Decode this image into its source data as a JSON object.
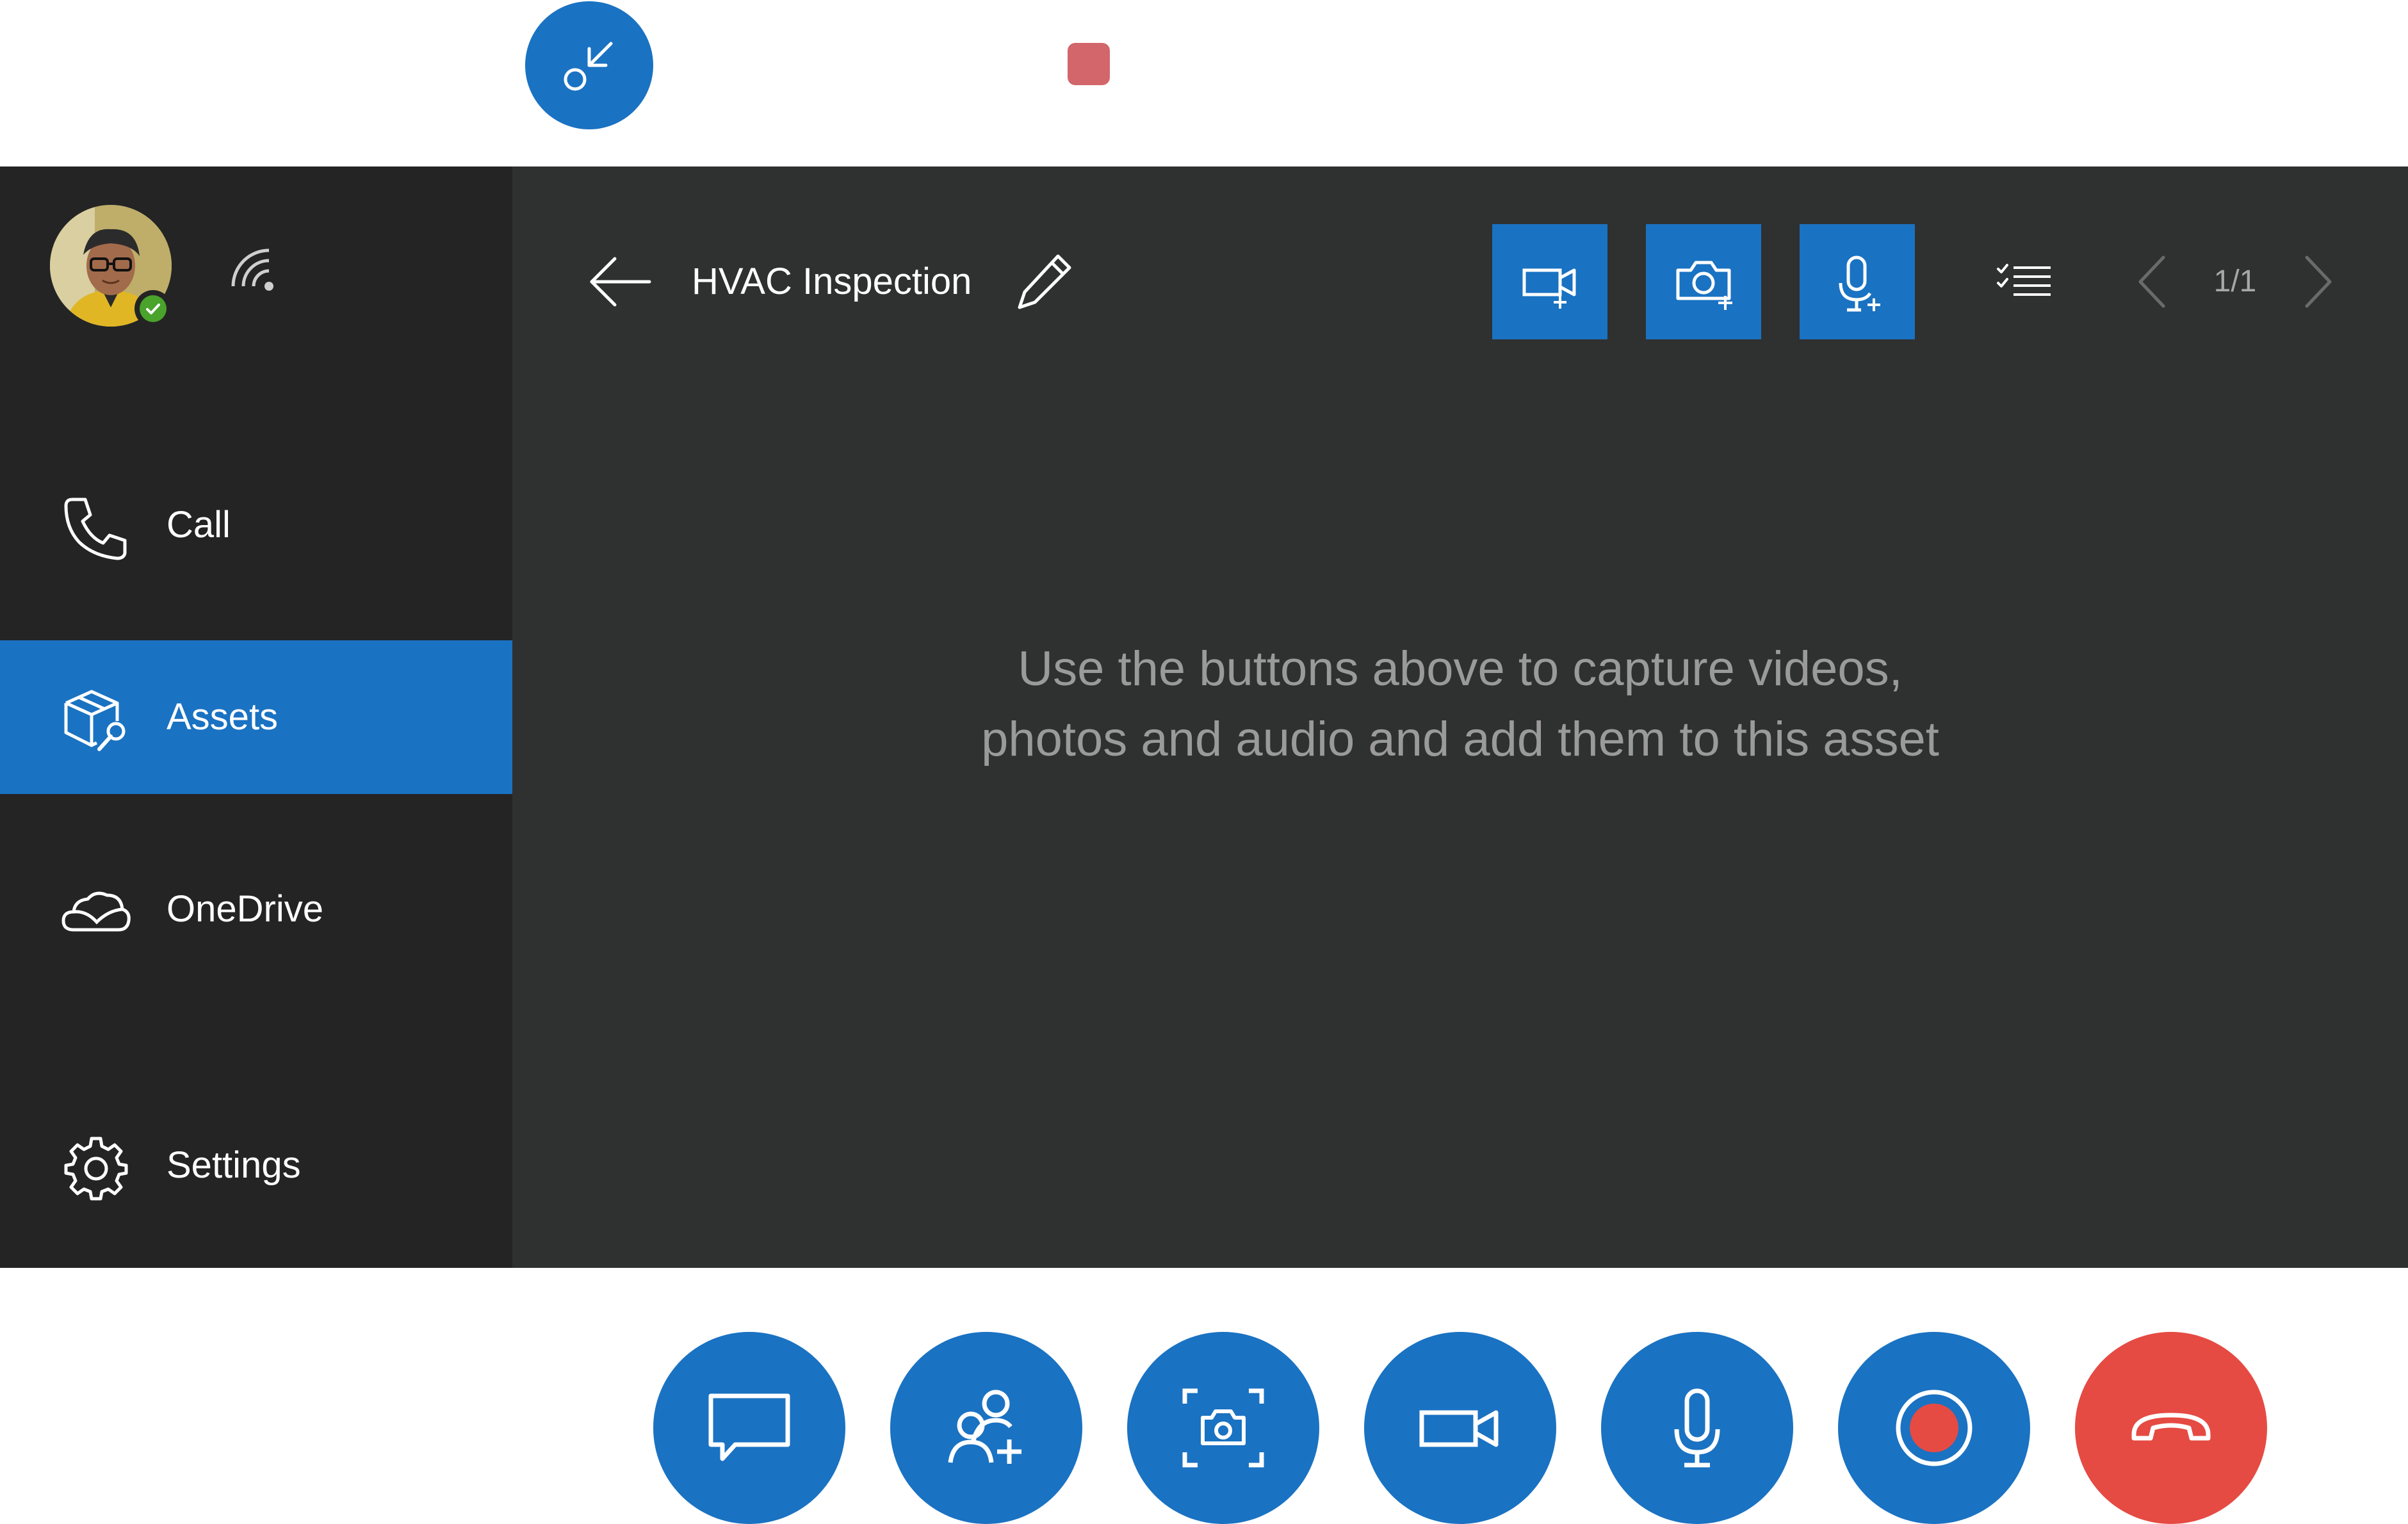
{
  "window": {
    "collapse_icon": "minimize-arrow-icon",
    "recording_indicator_color": "#d2666b"
  },
  "profile": {
    "presence_status": "available",
    "presence_color": "#4aa32b",
    "signal_icon": "wifi-signal-icon"
  },
  "sidebar": {
    "items": [
      {
        "label": "Call",
        "icon": "phone-icon",
        "selected": false
      },
      {
        "label": "Assets",
        "icon": "assets-icon",
        "selected": true
      },
      {
        "label": "OneDrive",
        "icon": "cloud-icon",
        "selected": false
      },
      {
        "label": "Settings",
        "icon": "gear-icon",
        "selected": false
      }
    ]
  },
  "asset": {
    "title": "HVAC Inspection",
    "page": "1/1",
    "empty_message_line1": "Use the buttons above to capture videos,",
    "empty_message_line2": "photos and audio and add them to this asset"
  },
  "toolbar": {
    "buttons": [
      "add-video-icon",
      "add-photo-icon",
      "add-audio-icon",
      "checklist-icon"
    ]
  },
  "call_controls": {
    "buttons": [
      "chat-icon",
      "add-people-icon",
      "snapshot-icon",
      "video-camera-icon",
      "microphone-icon",
      "record-icon",
      "end-call-icon"
    ]
  },
  "colors": {
    "accent": "#1a72c2",
    "sidebar_bg": "#242424",
    "main_bg": "#2f3030",
    "end_call": "#e54b43",
    "record_dot": "#e54b43"
  }
}
